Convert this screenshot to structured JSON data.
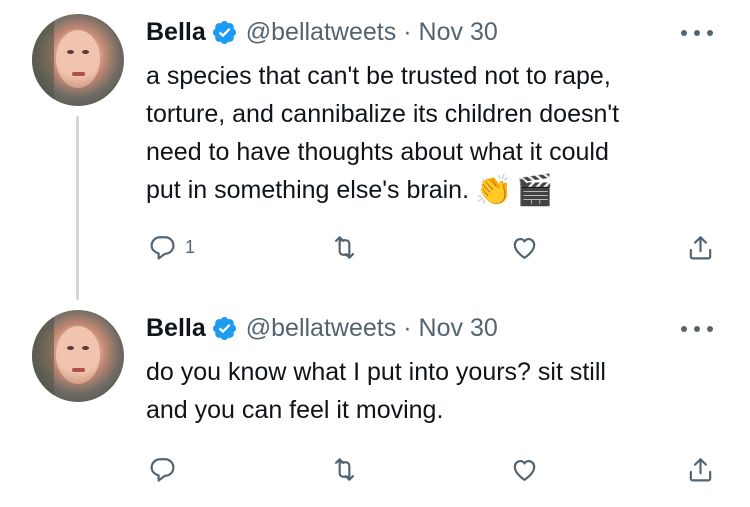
{
  "tweets": [
    {
      "author_name": "Bella",
      "handle": "@bellatweets",
      "separator": "·",
      "date": "Nov 30",
      "text": "a species that can't be trusted not to rape,\ntorture, and  cannibalize its children doesn't\nneed to have thoughts about what it could\nput in something else's brain.",
      "emoji_1": "👏",
      "emoji_2": "🎬",
      "reply_count": "1",
      "retweet_count": "",
      "like_count": ""
    },
    {
      "author_name": "Bella",
      "handle": "@bellatweets",
      "separator": "·",
      "date": "Nov 30",
      "text": "do you know what I put into yours? sit still\nand you can feel it moving.",
      "reply_count": "",
      "retweet_count": "",
      "like_count": ""
    }
  ],
  "colors": {
    "verified": "#1d9bf0",
    "secondary_text": "#536471",
    "thread_line": "#cfd9de"
  }
}
